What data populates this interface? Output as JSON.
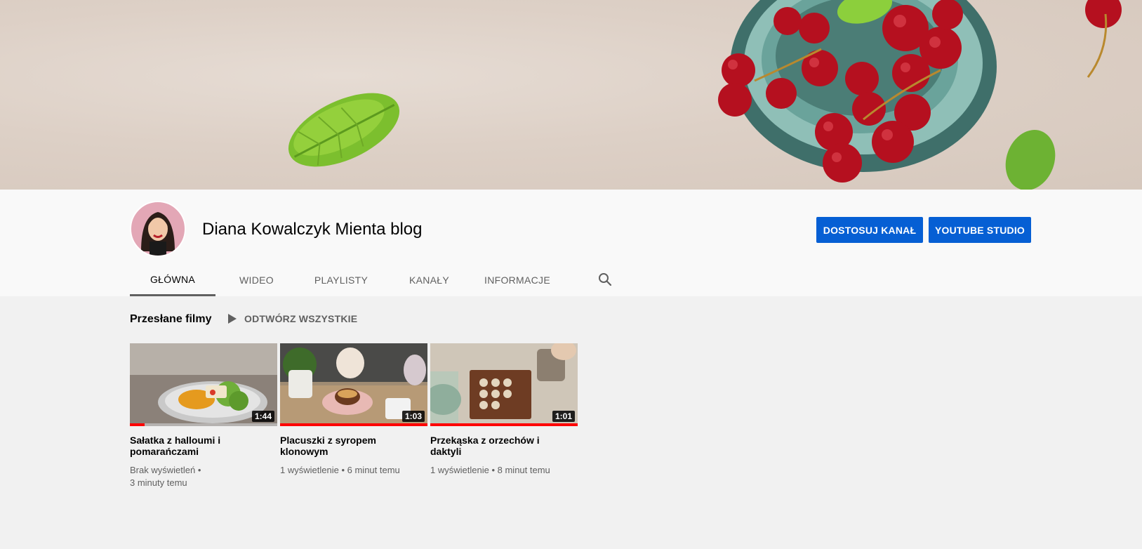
{
  "channel": {
    "name": "Diana Kowalczyk Mienta blog",
    "customize_label": "DOSTOSUJ KANAŁ",
    "studio_label": "YOUTUBE STUDIO"
  },
  "tabs": [
    {
      "label": "GŁÓWNA",
      "active": true
    },
    {
      "label": "WIDEO",
      "active": false
    },
    {
      "label": "PLAYLISTY",
      "active": false
    },
    {
      "label": "KANAŁY",
      "active": false
    },
    {
      "label": "INFORMACJE",
      "active": false
    }
  ],
  "section": {
    "title": "Przesłane filmy",
    "play_all_label": "ODTWÓRZ WSZYSTKIE"
  },
  "videos": [
    {
      "title": "Sałatka z halloumi i pomarańczami",
      "duration": "1:44",
      "views": "Brak wyświetleń",
      "separator": "•",
      "age": "3 minuty temu",
      "watched_fraction": 0.1
    },
    {
      "title": "Placuszki z syropem klonowym",
      "duration": "1:03",
      "views": "1 wyświetlenie",
      "separator": "•",
      "age": "6 minut temu",
      "watched_fraction": 1.0
    },
    {
      "title": "Przekąska z orzechów i daktyli",
      "duration": "1:01",
      "views": "1 wyświetlenie",
      "separator": "•",
      "age": "8 minut temu",
      "watched_fraction": 1.0
    }
  ],
  "colors": {
    "accent_button": "#065fd4",
    "progress_red": "#ff0000",
    "tab_indicator": "#606060"
  },
  "icons": {
    "search": "search-icon",
    "play": "play-icon"
  }
}
